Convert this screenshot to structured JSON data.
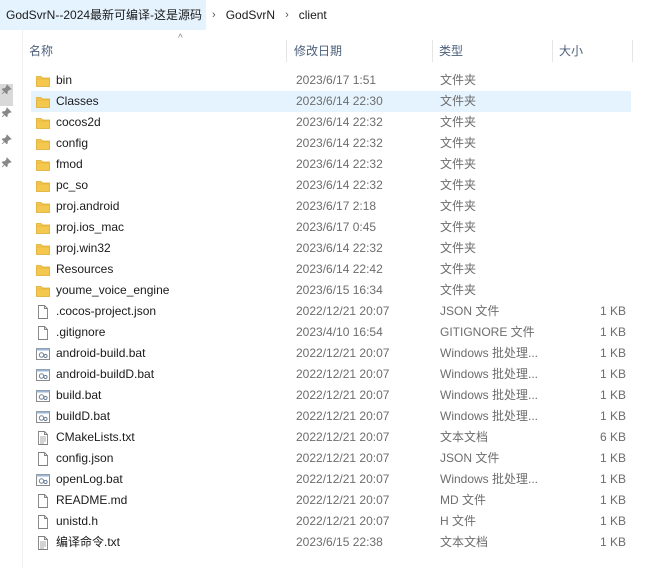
{
  "breadcrumb": {
    "items": [
      "GodSvrN--2024最新可编译-这是源码",
      "GodSvrN",
      "client"
    ],
    "separator": "›"
  },
  "columns": {
    "name": "名称",
    "date": "修改日期",
    "type": "类型",
    "size": "大小"
  },
  "colors": {
    "folder": "#f4c84f",
    "folder_dark": "#dcaa2c",
    "selection": "#e5f3ff",
    "header_text": "#4c607a"
  },
  "files": [
    {
      "name": "bin",
      "date": "2023/6/17 1:51",
      "type": "文件夹",
      "size": "",
      "icon": "folder-icon"
    },
    {
      "name": "Classes",
      "date": "2023/6/14 22:30",
      "type": "文件夹",
      "size": "",
      "icon": "folder-icon",
      "selected": true
    },
    {
      "name": "cocos2d",
      "date": "2023/6/14 22:32",
      "type": "文件夹",
      "size": "",
      "icon": "folder-icon"
    },
    {
      "name": "config",
      "date": "2023/6/14 22:32",
      "type": "文件夹",
      "size": "",
      "icon": "folder-icon"
    },
    {
      "name": "fmod",
      "date": "2023/6/14 22:32",
      "type": "文件夹",
      "size": "",
      "icon": "folder-icon"
    },
    {
      "name": "pc_so",
      "date": "2023/6/14 22:32",
      "type": "文件夹",
      "size": "",
      "icon": "folder-icon"
    },
    {
      "name": "proj.android",
      "date": "2023/6/17 2:18",
      "type": "文件夹",
      "size": "",
      "icon": "folder-icon"
    },
    {
      "name": "proj.ios_mac",
      "date": "2023/6/17 0:45",
      "type": "文件夹",
      "size": "",
      "icon": "folder-icon"
    },
    {
      "name": "proj.win32",
      "date": "2023/6/14 22:32",
      "type": "文件夹",
      "size": "",
      "icon": "folder-icon"
    },
    {
      "name": "Resources",
      "date": "2023/6/14 22:42",
      "type": "文件夹",
      "size": "",
      "icon": "folder-icon"
    },
    {
      "name": "youme_voice_engine",
      "date": "2023/6/15 16:34",
      "type": "文件夹",
      "size": "",
      "icon": "folder-icon"
    },
    {
      "name": ".cocos-project.json",
      "date": "2022/12/21 20:07",
      "type": "JSON 文件",
      "size": "1 KB",
      "icon": "file-icon"
    },
    {
      "name": ".gitignore",
      "date": "2023/4/10 16:54",
      "type": "GITIGNORE 文件",
      "size": "1 KB",
      "icon": "file-icon"
    },
    {
      "name": "android-build.bat",
      "date": "2022/12/21 20:07",
      "type": "Windows 批处理...",
      "size": "1 KB",
      "icon": "batch-file-icon"
    },
    {
      "name": "android-buildD.bat",
      "date": "2022/12/21 20:07",
      "type": "Windows 批处理...",
      "size": "1 KB",
      "icon": "batch-file-icon"
    },
    {
      "name": "build.bat",
      "date": "2022/12/21 20:07",
      "type": "Windows 批处理...",
      "size": "1 KB",
      "icon": "batch-file-icon"
    },
    {
      "name": "buildD.bat",
      "date": "2022/12/21 20:07",
      "type": "Windows 批处理...",
      "size": "1 KB",
      "icon": "batch-file-icon"
    },
    {
      "name": "CMakeLists.txt",
      "date": "2022/12/21 20:07",
      "type": "文本文档",
      "size": "6 KB",
      "icon": "text-file-icon"
    },
    {
      "name": "config.json",
      "date": "2022/12/21 20:07",
      "type": "JSON 文件",
      "size": "1 KB",
      "icon": "file-icon"
    },
    {
      "name": "openLog.bat",
      "date": "2022/12/21 20:07",
      "type": "Windows 批处理...",
      "size": "1 KB",
      "icon": "batch-file-icon"
    },
    {
      "name": "README.md",
      "date": "2022/12/21 20:07",
      "type": "MD 文件",
      "size": "1 KB",
      "icon": "file-icon"
    },
    {
      "name": "unistd.h",
      "date": "2022/12/21 20:07",
      "type": "H 文件",
      "size": "1 KB",
      "icon": "file-icon"
    },
    {
      "name": "编译命令.txt",
      "date": "2023/6/15 22:38",
      "type": "文本文档",
      "size": "1 KB",
      "icon": "text-file-icon"
    }
  ]
}
